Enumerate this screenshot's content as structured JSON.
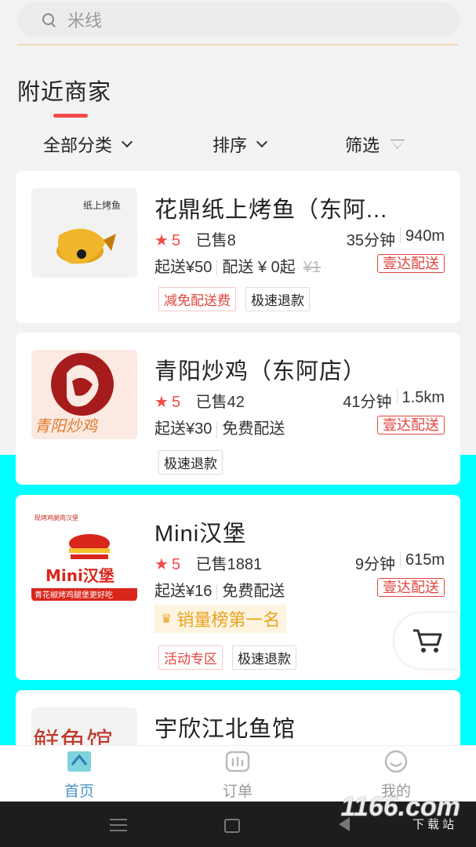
{
  "search": {
    "placeholder": "米线"
  },
  "section_title": "附近商家",
  "filters": {
    "category": "全部分类",
    "sort": "排序",
    "filter": "筛选"
  },
  "stores": [
    {
      "name": "花鼎纸上烤鱼（东阿...",
      "rating": "5",
      "sold": "已售8",
      "time": "35分钟",
      "distance": "940m",
      "min_order": "起送¥50",
      "delivery": "配送 ¥ 0起",
      "original_fee": "¥1",
      "delivery_tag": "壹达配送",
      "logo_text": "纸上烤鱼",
      "tags": [
        "减免配送费",
        "极速退款"
      ]
    },
    {
      "name": "青阳炒鸡（东阿店）",
      "rating": "5",
      "sold": "已售42",
      "time": "41分钟",
      "distance": "1.5km",
      "min_order": "起送¥30",
      "delivery": "免费配送",
      "delivery_tag": "壹达配送",
      "logo_text": "青阳炒鸡",
      "tags": [
        "极速退款"
      ]
    },
    {
      "name": "Mini汉堡",
      "rating": "5",
      "sold": "已售1881",
      "time": "9分钟",
      "distance": "615m",
      "min_order": "起送¥16",
      "delivery": "免费配送",
      "delivery_tag": "壹达配送",
      "rank": "销量榜第一名",
      "logo_top": "现烤鸡腿肉汉堡",
      "logo_brand": "Mini汉堡",
      "logo_bottom": "青花椒烤鸡腿堡更好吃",
      "tags": [
        "活动专区",
        "极速退款"
      ]
    },
    {
      "name": "宇欣江北鱼馆",
      "logo_text": "鲜鱼馆"
    }
  ],
  "nav": {
    "home": "首页",
    "orders": "订单",
    "mine": "我的"
  },
  "watermark": {
    "main": "1166.com",
    "sub": "下载站"
  },
  "colors": {
    "accent_red": "#f14b48",
    "nav_active": "#4d93c8",
    "cyan_bg": "#00ffff"
  }
}
